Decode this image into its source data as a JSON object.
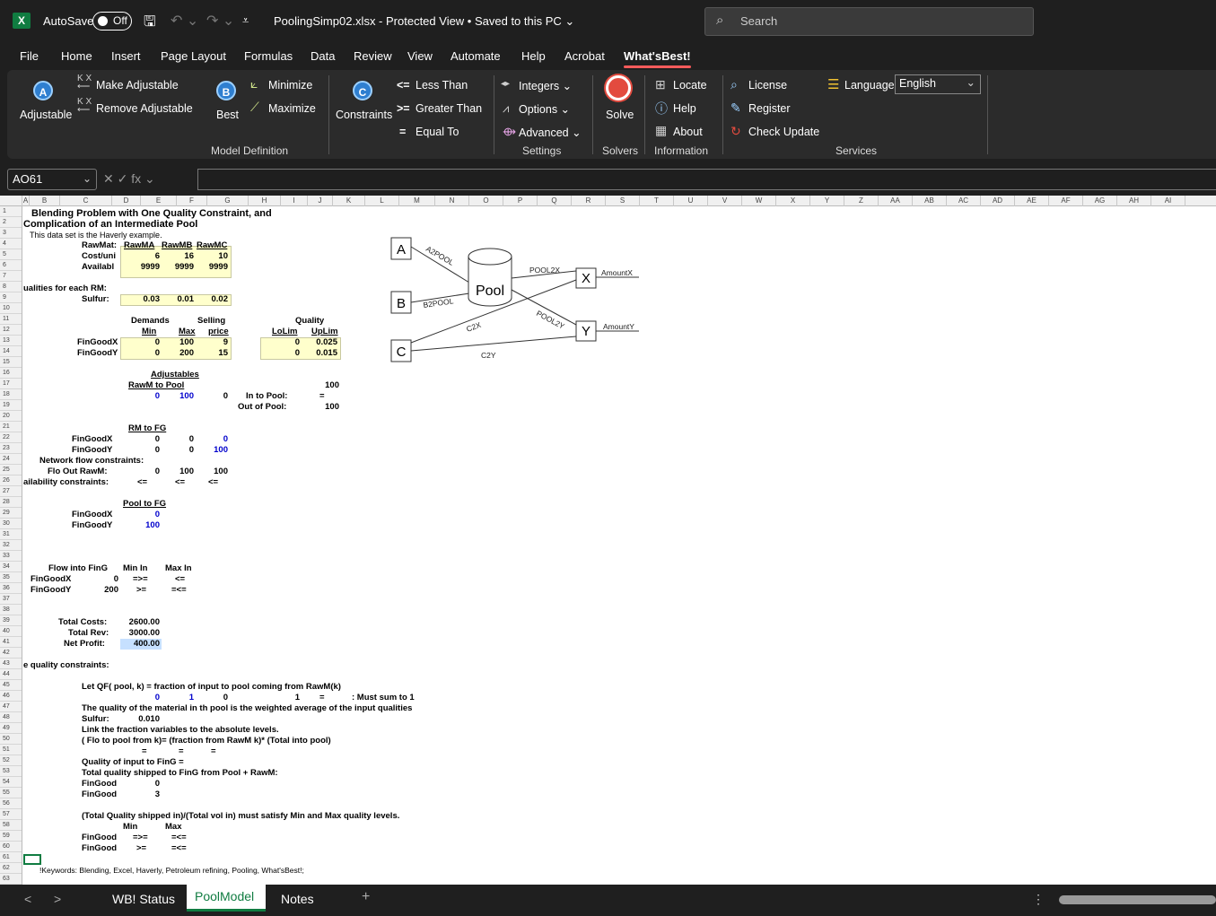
{
  "titlebar": {
    "app_logo": "X",
    "autosave_label": "AutoSave",
    "autosave_state": "Off",
    "doc_title": "PoolingSimp02.xlsx  -  Protected View • Saved to this PC ⌄",
    "search_placeholder": "Search",
    "icons": [
      "save-icon",
      "undo-icon",
      "redo-icon",
      "customize-qat-icon",
      "search-icon"
    ]
  },
  "menu": [
    "File",
    "Home",
    "Insert",
    "Page Layout",
    "Formulas",
    "Data",
    "Review",
    "View",
    "Automate",
    "Help",
    "Acrobat",
    "What'sBest!"
  ],
  "ribbon": {
    "adjustable": "Adjustable",
    "make_adjustable": "Make Adjustable",
    "remove_adjustable": "Remove Adjustable",
    "best": "Best",
    "minimize": "Minimize",
    "maximize": "Maximize",
    "constraints": "Constraints",
    "less_than": "Less Than",
    "greater_than": "Greater Than",
    "equal_to": "Equal To",
    "integers": "Integers ⌄",
    "options": "Options ⌄",
    "advanced": "Advanced ⌄",
    "solve": "Solve",
    "locate": "Locate",
    "help": "Help",
    "about": "About",
    "license": "License",
    "register": "Register",
    "check_update": "Check Update",
    "language": "Language",
    "language_value": "English",
    "groups": {
      "model_definition": "Model Definition",
      "settings": "Settings",
      "solvers": "Solvers",
      "information": "Information",
      "services": "Services"
    },
    "glyphs": {
      "lt": "<=",
      "gt": ">=",
      "eq": "=",
      "a": "A",
      "b": "B",
      "c": "C"
    }
  },
  "formula_bar": {
    "name_box": "AO61",
    "fx_glyphs": "✕  ✓  fx ⌄",
    "formula": ""
  },
  "columns": [
    "A",
    "B",
    "C",
    "D",
    "E",
    "F",
    "G",
    "H",
    "I",
    "J",
    "K",
    "L",
    "M",
    "N",
    "O",
    "P",
    "Q",
    "R",
    "S",
    "T",
    "U",
    "V",
    "W",
    "X",
    "Y",
    "Z",
    "AA",
    "AB",
    "AC",
    "AD",
    "AE",
    "AF",
    "AG",
    "AH",
    "AI"
  ],
  "rows": [
    "1",
    "2",
    "3",
    "4",
    "5",
    "6",
    "7",
    "8",
    "9",
    "10",
    "11",
    "12",
    "13",
    "14",
    "15",
    "16",
    "17",
    "18",
    "19",
    "20",
    "21",
    "22",
    "23",
    "24",
    "25",
    "26",
    "27",
    "28",
    "29",
    "30",
    "31",
    "32",
    "33",
    "34",
    "35",
    "36",
    "37",
    "38",
    "39",
    "40",
    "41",
    "42",
    "43",
    "44",
    "45",
    "46",
    "47",
    "48",
    "49",
    "50",
    "51",
    "52",
    "53",
    "54",
    "55",
    "56",
    "57",
    "58",
    "59",
    "60",
    "61",
    "62",
    "63"
  ],
  "cells": {
    "r1": "Blending Problem with One Quality Constraint, and",
    "r2": "Complication of an Intermediate Pool",
    "r3": "This data set is the Haverly example.",
    "r4_lbl": "RawMat:",
    "r4_a": "RawMA",
    "r4_b": "RawMB",
    "r4_c": "RawMC",
    "r5_lbl": "Cost/uni",
    "r5_a": "6",
    "r5_b": "16",
    "r5_c": "10",
    "r6_lbl": "Availabl",
    "r6_a": "9999",
    "r6_b": "9999",
    "r6_c": "9999",
    "r8": "ualities for each RM:",
    "r9_lbl": "Sulfur:",
    "r9_a": "0.03",
    "r9_b": "0.01",
    "r9_c": "0.02",
    "r11_dem": "Demands",
    "r11_sell": "Selling",
    "r11_q": "Quality",
    "r12_min": "Min",
    "r12_max": "Max",
    "r12_price": "price",
    "r12_lolim": "LoLim",
    "r12_uplim": "UpLim",
    "r13_lbl": "FinGoodX",
    "r13_min": "0",
    "r13_max": "100",
    "r13_price": "9",
    "r13_lo": "0",
    "r13_up": "0.025",
    "r14_lbl": "FinGoodY",
    "r14_min": "0",
    "r14_max": "200",
    "r14_price": "15",
    "r14_lo": "0",
    "r14_up": "0.015",
    "r16": "Adjustables",
    "r17": "RawM to Pool",
    "r17_h": "100",
    "r18_a": "0",
    "r18_b": "100",
    "r18_c": "0",
    "r18_lbl": "In to Pool:",
    "r18_h": "=",
    "r19_lbl": "Out of Pool:",
    "r19_h": "100",
    "r21": "RM to FG",
    "r22_lbl": "FinGoodX",
    "r22_a": "0",
    "r22_b": "0",
    "r22_c": "0",
    "r23_lbl": "FinGoodY",
    "r23_a": "0",
    "r23_b": "0",
    "r23_c": "100",
    "r24": "Network flow constraints:",
    "r25_lbl": "Flo Out RawM:",
    "r25_a": "0",
    "r25_b": "100",
    "r25_c": "100",
    "r26_lbl": "ailability constraints:",
    "r26_a": "<=",
    "r26_b": "<=",
    "r26_c": "<=",
    "r28": "Pool to FG",
    "r29_lbl": "FinGoodX",
    "r29_v": "0",
    "r30_lbl": "FinGoodY",
    "r30_v": "100",
    "r34_a": "Flow into FinG",
    "r34_b": "Min In",
    "r34_c": "Max In",
    "r35_lbl": "FinGoodX",
    "r35_v": "0",
    "r35_min": "=>=",
    "r35_max": "<=",
    "r36_lbl": "FinGoodY",
    "r36_v": "200",
    "r36_min": ">=",
    "r36_max": "=<=",
    "r39_lbl": "Total Costs:",
    "r39_v": "2600.00",
    "r40_lbl": "Total Rev:",
    "r40_v": "3000.00",
    "r41_lbl": "Net Profit:",
    "r41_v": "400.00",
    "r43": "e quality constraints:",
    "r45": "Let QF( pool, k) = fraction of input to pool coming from RawM(k)",
    "r46_a": "0",
    "r46_b": "1",
    "r46_c": "0",
    "r46_d": "1",
    "r46_e": "=",
    "r46_f": ": Must sum to 1",
    "r47": "The quality of the material in th pool is the weighted average of the input qualities",
    "r48_lbl": "Sulfur:",
    "r48_v": "0.010",
    "r49": "Link the fraction variables to the absolute levels.",
    "r50": "( Flo to pool from k)= (fraction from RawM k)* (Total into pool)",
    "r51_a": "=",
    "r51_b": "=",
    "r51_c": "=",
    "r52": "Quality of input to  FinG =",
    "r53": "Total quality shipped to FinG from Pool + RawM:",
    "r54_lbl": "FinGood",
    "r54_v": "0",
    "r55_lbl": "FinGood",
    "r55_v": "3",
    "r57": "(Total Quality shipped in)/(Total vol in) must satisfy Min and Max  quality levels.",
    "r58_min": "Min",
    "r58_max": "Max",
    "r59_lbl": "FinGood",
    "r59_min": "=>=",
    "r59_max": "=<=",
    "r60_lbl": "FinGood",
    "r60_min": ">=",
    "r60_max": "=<=",
    "r62": "!Keywords: Blending, Excel, Haverly, Petroleum refining, Pooling, What'sBest!;"
  },
  "diagram": {
    "nodes": {
      "a": "A",
      "b": "B",
      "c": "C",
      "pool": "Pool",
      "x": "X",
      "y": "Y"
    },
    "edges": {
      "a2pool": "A2POOL",
      "b2pool": "B2POOL",
      "pool2x": "POOL2X",
      "pool2y": "POOL2Y",
      "c2x": "C2X",
      "c2y": "C2Y",
      "amountx": "AmountX",
      "amounty": "AmountY"
    }
  },
  "tabs": {
    "status": "WB! Status",
    "poolmodel": "PoolModel",
    "notes": "Notes",
    "add": "+",
    "more": "⋮",
    "prev": "<",
    "next": ">"
  },
  "colors": {
    "excel_green": "#107c41",
    "ribbon_bg": "#2b2b2b",
    "title_bg": "#1f1f1f",
    "input_yellow": "#ffffcc",
    "adjustable_blue": "#0000cc",
    "selected_cell": "#c6e0ff"
  }
}
